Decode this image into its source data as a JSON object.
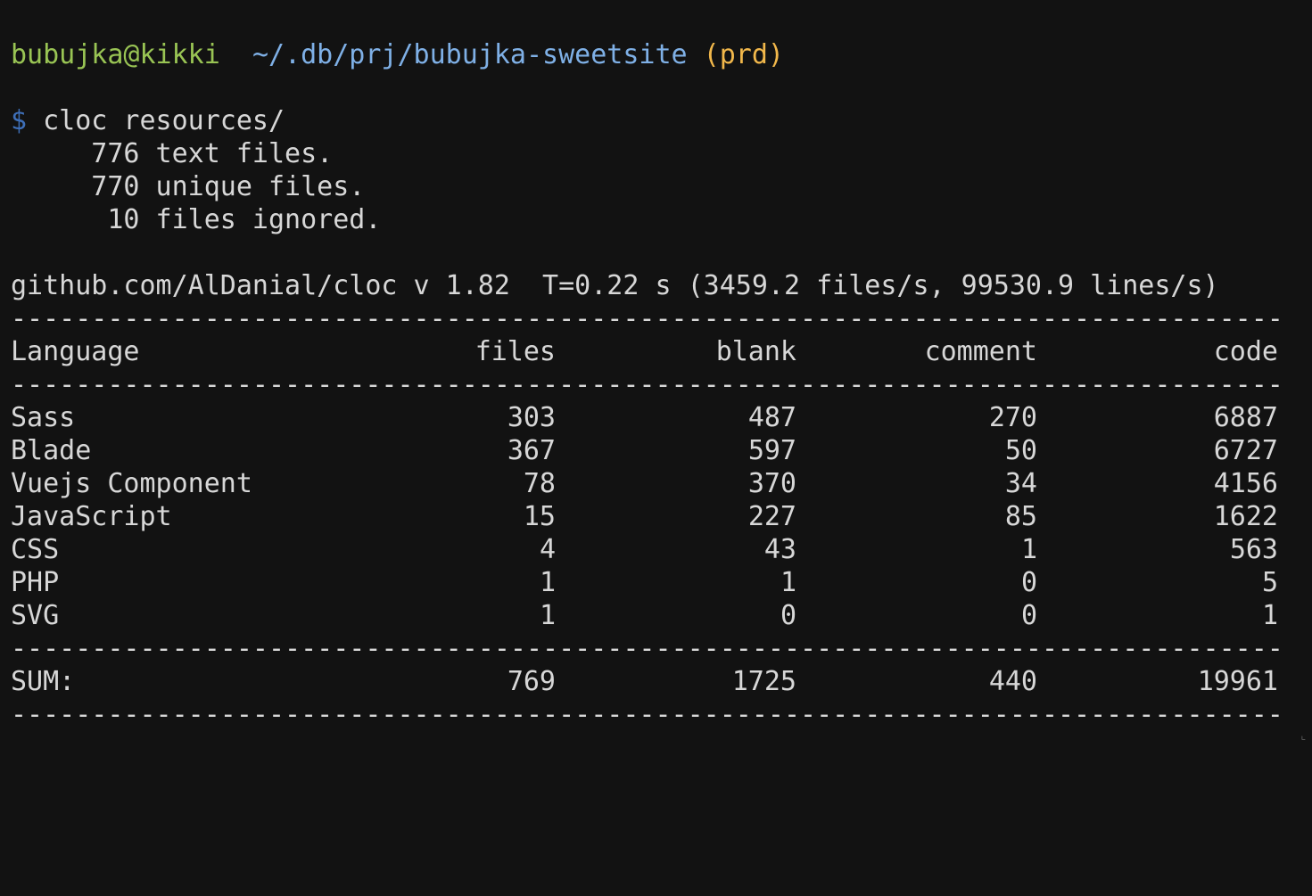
{
  "prompt": {
    "user_host": "bubujka@kikki",
    "path": "~/.db/prj/bubujka-sweetsite",
    "branch": "(prd)",
    "symbol": "$",
    "command": "cloc resources/"
  },
  "summary": {
    "text_files": "     776 text files.",
    "unique_files": "     770 unique files.",
    "ignored_files": "      10 files ignored."
  },
  "header_info": "github.com/AlDanial/cloc v 1.82  T=0.22 s (3459.2 files/s, 99530.9 lines/s)",
  "table": {
    "columns": [
      "Language",
      "files",
      "blank",
      "comment",
      "code"
    ],
    "rows": [
      {
        "language": "Sass",
        "files": "303",
        "blank": "487",
        "comment": "270",
        "code": "6887"
      },
      {
        "language": "Blade",
        "files": "367",
        "blank": "597",
        "comment": "50",
        "code": "6727"
      },
      {
        "language": "Vuejs Component",
        "files": "78",
        "blank": "370",
        "comment": "34",
        "code": "4156"
      },
      {
        "language": "JavaScript",
        "files": "15",
        "blank": "227",
        "comment": "85",
        "code": "1622"
      },
      {
        "language": "CSS",
        "files": "4",
        "blank": "43",
        "comment": "1",
        "code": "563"
      },
      {
        "language": "PHP",
        "files": "1",
        "blank": "1",
        "comment": "0",
        "code": "5"
      },
      {
        "language": "SVG",
        "files": "1",
        "blank": "0",
        "comment": "0",
        "code": "1"
      }
    ],
    "sum": {
      "language": "SUM:",
      "files": "769",
      "blank": "1725",
      "comment": "440",
      "code": "19961"
    }
  },
  "rule": "-------------------------------------------------------------------------------"
}
